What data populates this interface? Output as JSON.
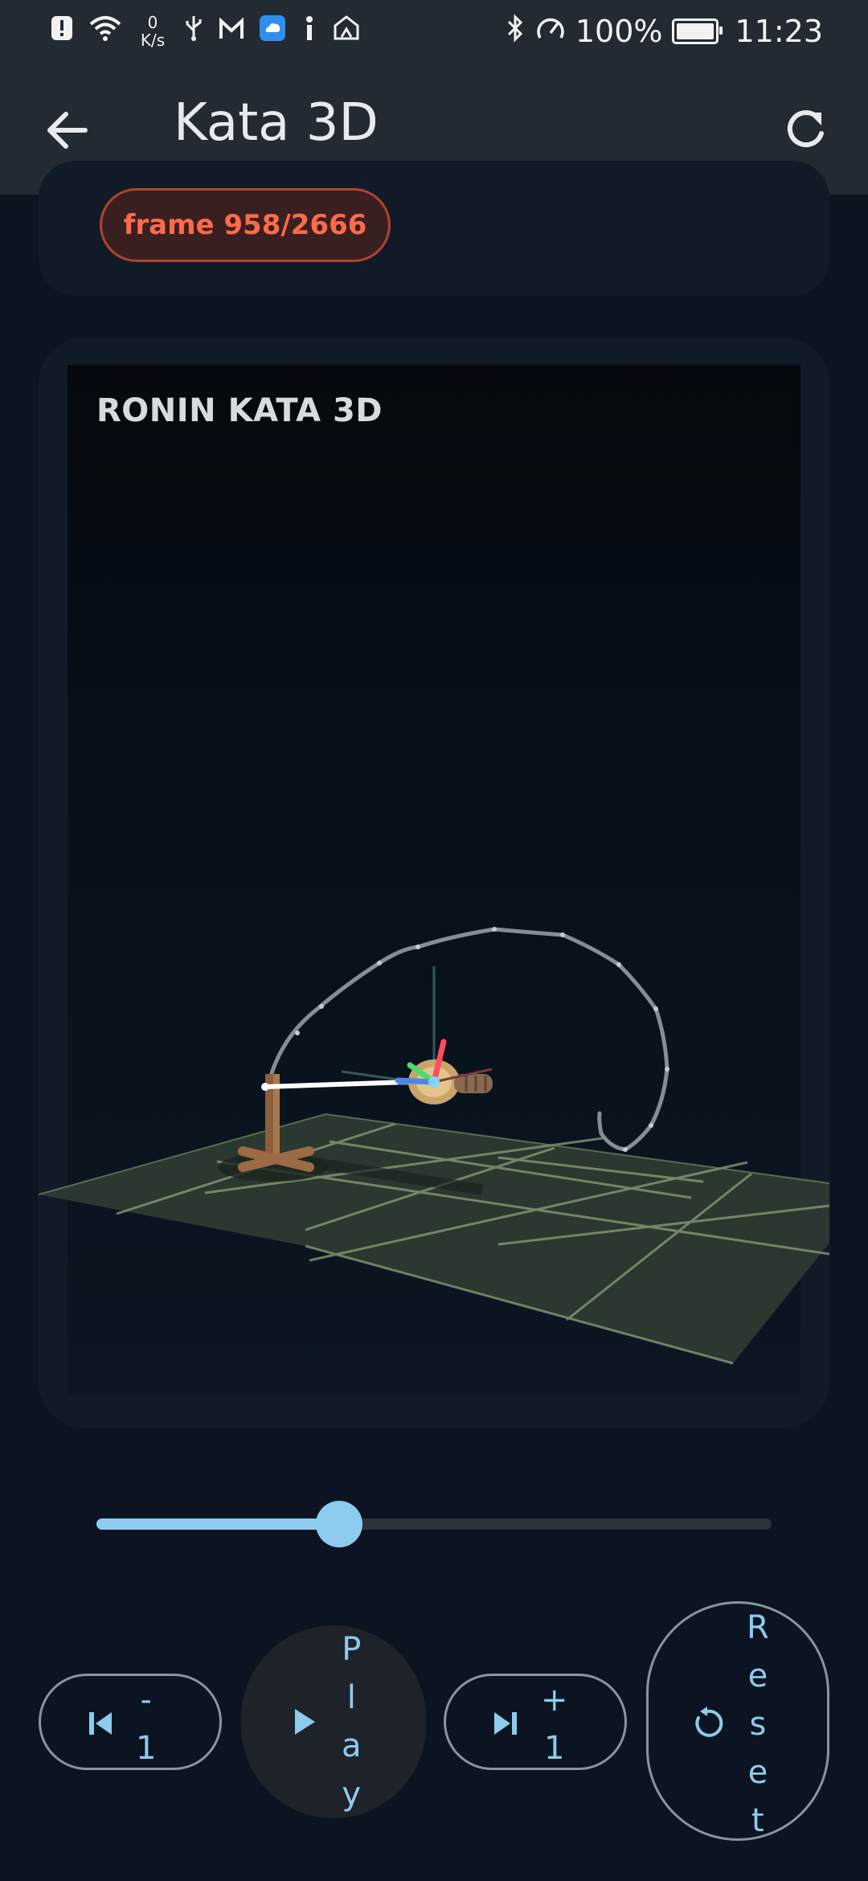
{
  "status_bar": {
    "net_speed_value": "0",
    "net_speed_unit": "K/s",
    "battery_percent": "100%",
    "time": "11:23"
  },
  "app_bar": {
    "title": "Kata 3D"
  },
  "frame_info": {
    "label": "frame 958/2666"
  },
  "scene": {
    "title": "RONIN KATA 3D"
  },
  "playback": {
    "progress": 0.359
  },
  "controls": {
    "step_back": [
      "-",
      "1"
    ],
    "play": [
      "P",
      "l",
      "a",
      "y"
    ],
    "step_forward": [
      "+",
      "1"
    ],
    "reset": [
      "R",
      "e",
      "s",
      "e",
      "t"
    ]
  },
  "colors": {
    "accent": "#8ccbee",
    "frame_text": "#ff6b4a",
    "background": "#0b1420"
  }
}
